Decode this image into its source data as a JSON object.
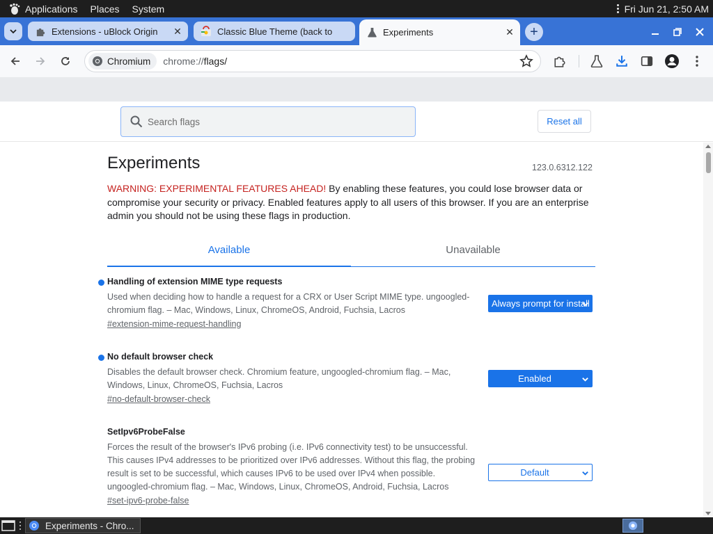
{
  "topbar": {
    "applications": "Applications",
    "places": "Places",
    "system": "System",
    "datetime": "Fri Jun 21,  2:50 AM"
  },
  "tabs": [
    {
      "title": "Extensions - uBlock Origin",
      "icon": "puzzle-icon",
      "active": false
    },
    {
      "title": "Classic Blue Theme (back to",
      "icon": "chrome-web-store-icon",
      "active": false
    },
    {
      "title": "Experiments",
      "icon": "flask-icon",
      "active": true
    }
  ],
  "omnibox": {
    "chip": "Chromium",
    "url_scheme": "chrome://",
    "url_path": "flags/"
  },
  "flags_page": {
    "search_placeholder": "Search flags",
    "reset_all": "Reset all",
    "title": "Experiments",
    "version": "123.0.6312.122",
    "warning_label": "WARNING: EXPERIMENTAL FEATURES AHEAD!",
    "warning_text": " By enabling these features, you could lose browser data or compromise your security or privacy. Enabled features apply to all users of this browser. If you are an enterprise admin you should not be using these flags in production.",
    "tab_available": "Available",
    "tab_unavailable": "Unavailable",
    "flags": [
      {
        "name": "Handling of extension MIME type requests",
        "description": "Used when deciding how to handle a request for a CRX or User Script MIME type. ungoogled-chromium flag. – Mac, Windows, Linux, ChromeOS, Android, Fuchsia, Lacros",
        "link": "#extension-mime-request-handling",
        "value": "Always prompt for install",
        "modified": true
      },
      {
        "name": "No default browser check",
        "description": "Disables the default browser check. Chromium feature, ungoogled-chromium flag. – Mac, Windows, Linux, ChromeOS, Fuchsia, Lacros",
        "link": "#no-default-browser-check",
        "value": "Enabled",
        "modified": true
      },
      {
        "name": "SetIpv6ProbeFalse",
        "description": "Forces the result of the browser's IPv6 probing (i.e. IPv6 connectivity test) to be unsuccessful. This causes IPv4 addresses to be prioritized over IPv6 addresses. Without this flag, the probing result is set to be successful, which causes IPv6 to be used over IPv4 when possible. ungoogled-chromium flag. – Mac, Windows, Linux, ChromeOS, Android, Fuchsia, Lacros",
        "link": "#set-ipv6-probe-false",
        "value": "Default",
        "modified": false
      }
    ]
  },
  "taskbar": {
    "window_title": "Experiments - Chro..."
  },
  "colors": {
    "accent": "#1a73e8",
    "tabstrip": "#3873d6",
    "warning": "#c5221f"
  }
}
